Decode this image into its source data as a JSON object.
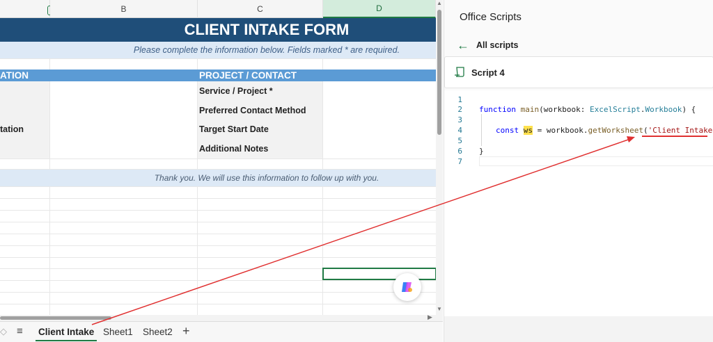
{
  "columns": [
    "B",
    "C",
    "D"
  ],
  "form": {
    "title": "CLIENT INTAKE FORM",
    "subtitle": "Please complete the information below. Fields marked * are required.",
    "section_left": "ATION",
    "section_right": "PROJECT / CONTACT",
    "left_row_label": "tation",
    "fields": [
      "Service / Project *",
      "Preferred Contact Method",
      "Target Start Date",
      "Additional Notes"
    ],
    "thanks": "Thank you. We will use this information to follow up with you."
  },
  "sheet_tabs": {
    "tabs": [
      "Client Intake",
      "Sheet1",
      "Sheet2"
    ],
    "active": "Client Intake",
    "add_label": "+"
  },
  "pane": {
    "title": "Office Scripts",
    "back_label": "All scripts",
    "script_name": "Script 4",
    "code": {
      "line_numbers": [
        "1",
        "2",
        "3",
        "4",
        "5",
        "6",
        "7"
      ],
      "line2": {
        "kw": "function",
        "fn": "main",
        "param": "(workbook: ",
        "type": "ExcelScript",
        "dot": ".",
        "type2": "Workbook",
        "end": ") {"
      },
      "line4": {
        "kw": "const",
        "var": "ws",
        "eq": " = workbook.",
        "fn": "getWorksheet",
        "open": "(",
        "str": "'Client Intake'",
        "close": ")"
      },
      "line6": "}"
    }
  },
  "colors": {
    "title_band": "#1f4e79",
    "section_band": "#5b9bd5",
    "light_band": "#dde9f6",
    "accent_green": "#1f7a44",
    "annotation_red": "#e03030"
  }
}
